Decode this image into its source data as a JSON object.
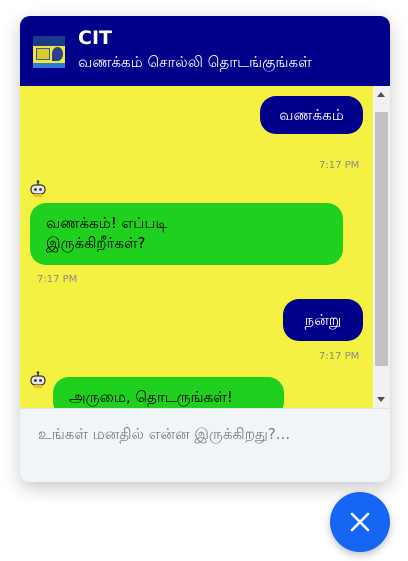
{
  "header": {
    "title": "CIT",
    "subtitle": "வணக்கம் சொல்லி தொடங்குங்கள்",
    "logo_icon": "cit-logo"
  },
  "messages": [
    {
      "sender": "user",
      "text": "வணக்கம்",
      "time": "7:17 PM"
    },
    {
      "sender": "bot",
      "text": "வணக்கம்! எப்படி இருக்கிறீர்கள்?",
      "time": "7:17 PM"
    },
    {
      "sender": "user",
      "text": "நன்று",
      "time": "7:17 PM"
    },
    {
      "sender": "bot",
      "text": "அருமை, தொடருங்கள்!",
      "time": ""
    }
  ],
  "composer": {
    "placeholder": "உங்கள் மனதில் என்ன இருக்கிறது?...",
    "value": ""
  },
  "colors": {
    "header_bg": "#00008b",
    "chat_bg": "#f4f142",
    "user_bubble": "#00008b",
    "bot_bubble": "#1fd01f",
    "fab_bg": "#1565f5"
  },
  "fab": {
    "icon": "close-icon"
  }
}
